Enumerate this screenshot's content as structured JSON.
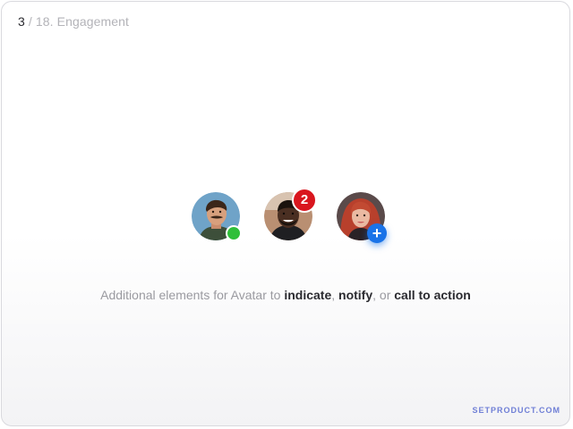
{
  "breadcrumb": {
    "page_number": "3",
    "separator": " / ",
    "section": "18. Engagement"
  },
  "avatars": [
    {
      "name": "avatar-man-mustache",
      "indicator": "online",
      "indicator_color": "#2fbf3a"
    },
    {
      "name": "avatar-man-smiling",
      "indicator": "count",
      "badge_count": "2",
      "indicator_color": "#d9161e"
    },
    {
      "name": "avatar-woman-red-hair",
      "indicator": "add",
      "add_symbol": "+",
      "indicator_color": "#1a73e8"
    }
  ],
  "caption": {
    "prefix": "Additional elements for Avatar to ",
    "word1": "indicate",
    "sep1": ", ",
    "word2": "notify",
    "sep2": ", or ",
    "word3": "call to action"
  },
  "brand": "SETPRODUCT.COM",
  "colors": {
    "muted_text": "#9a9aa0",
    "strong_text": "#2b2b30",
    "brand": "#6f7fd6"
  }
}
